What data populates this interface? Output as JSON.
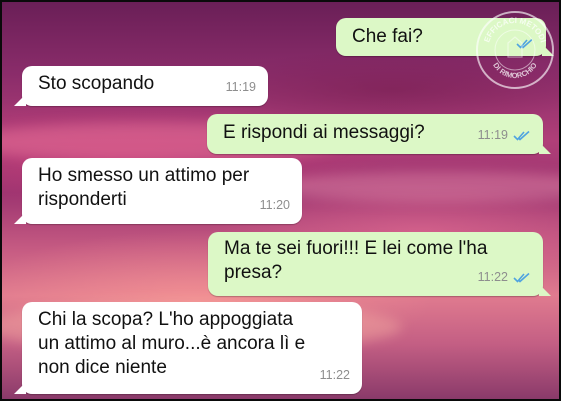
{
  "chat": {
    "messages": [
      {
        "direction": "outgoing",
        "text": "Che fai?",
        "time": "",
        "read": true
      },
      {
        "direction": "incoming",
        "text": "Sto scopando",
        "time": "11:19"
      },
      {
        "direction": "outgoing",
        "text": "E rispondi ai messaggi?",
        "time": "11:19",
        "read": true
      },
      {
        "direction": "incoming",
        "text": "Ho smesso un attimo per\nrisponderti",
        "time": "11:20"
      },
      {
        "direction": "outgoing",
        "text": "Ma te sei fuori!!! E lei come l'ha\npresa?",
        "time": "11:22",
        "read": true
      },
      {
        "direction": "incoming",
        "text": "Chi la scopa? L'ho appoggiata\nun attimo al muro...è ancora lì e\nnon dice niente",
        "time": "11:22"
      }
    ]
  },
  "watermark": {
    "top": "EFFICACI METODI",
    "bottom": "DI RIMORCHIO"
  },
  "colors": {
    "incoming": "#ffffff",
    "outgoing": "#dcf8c6",
    "read_ticks": "#4fa3e0"
  }
}
